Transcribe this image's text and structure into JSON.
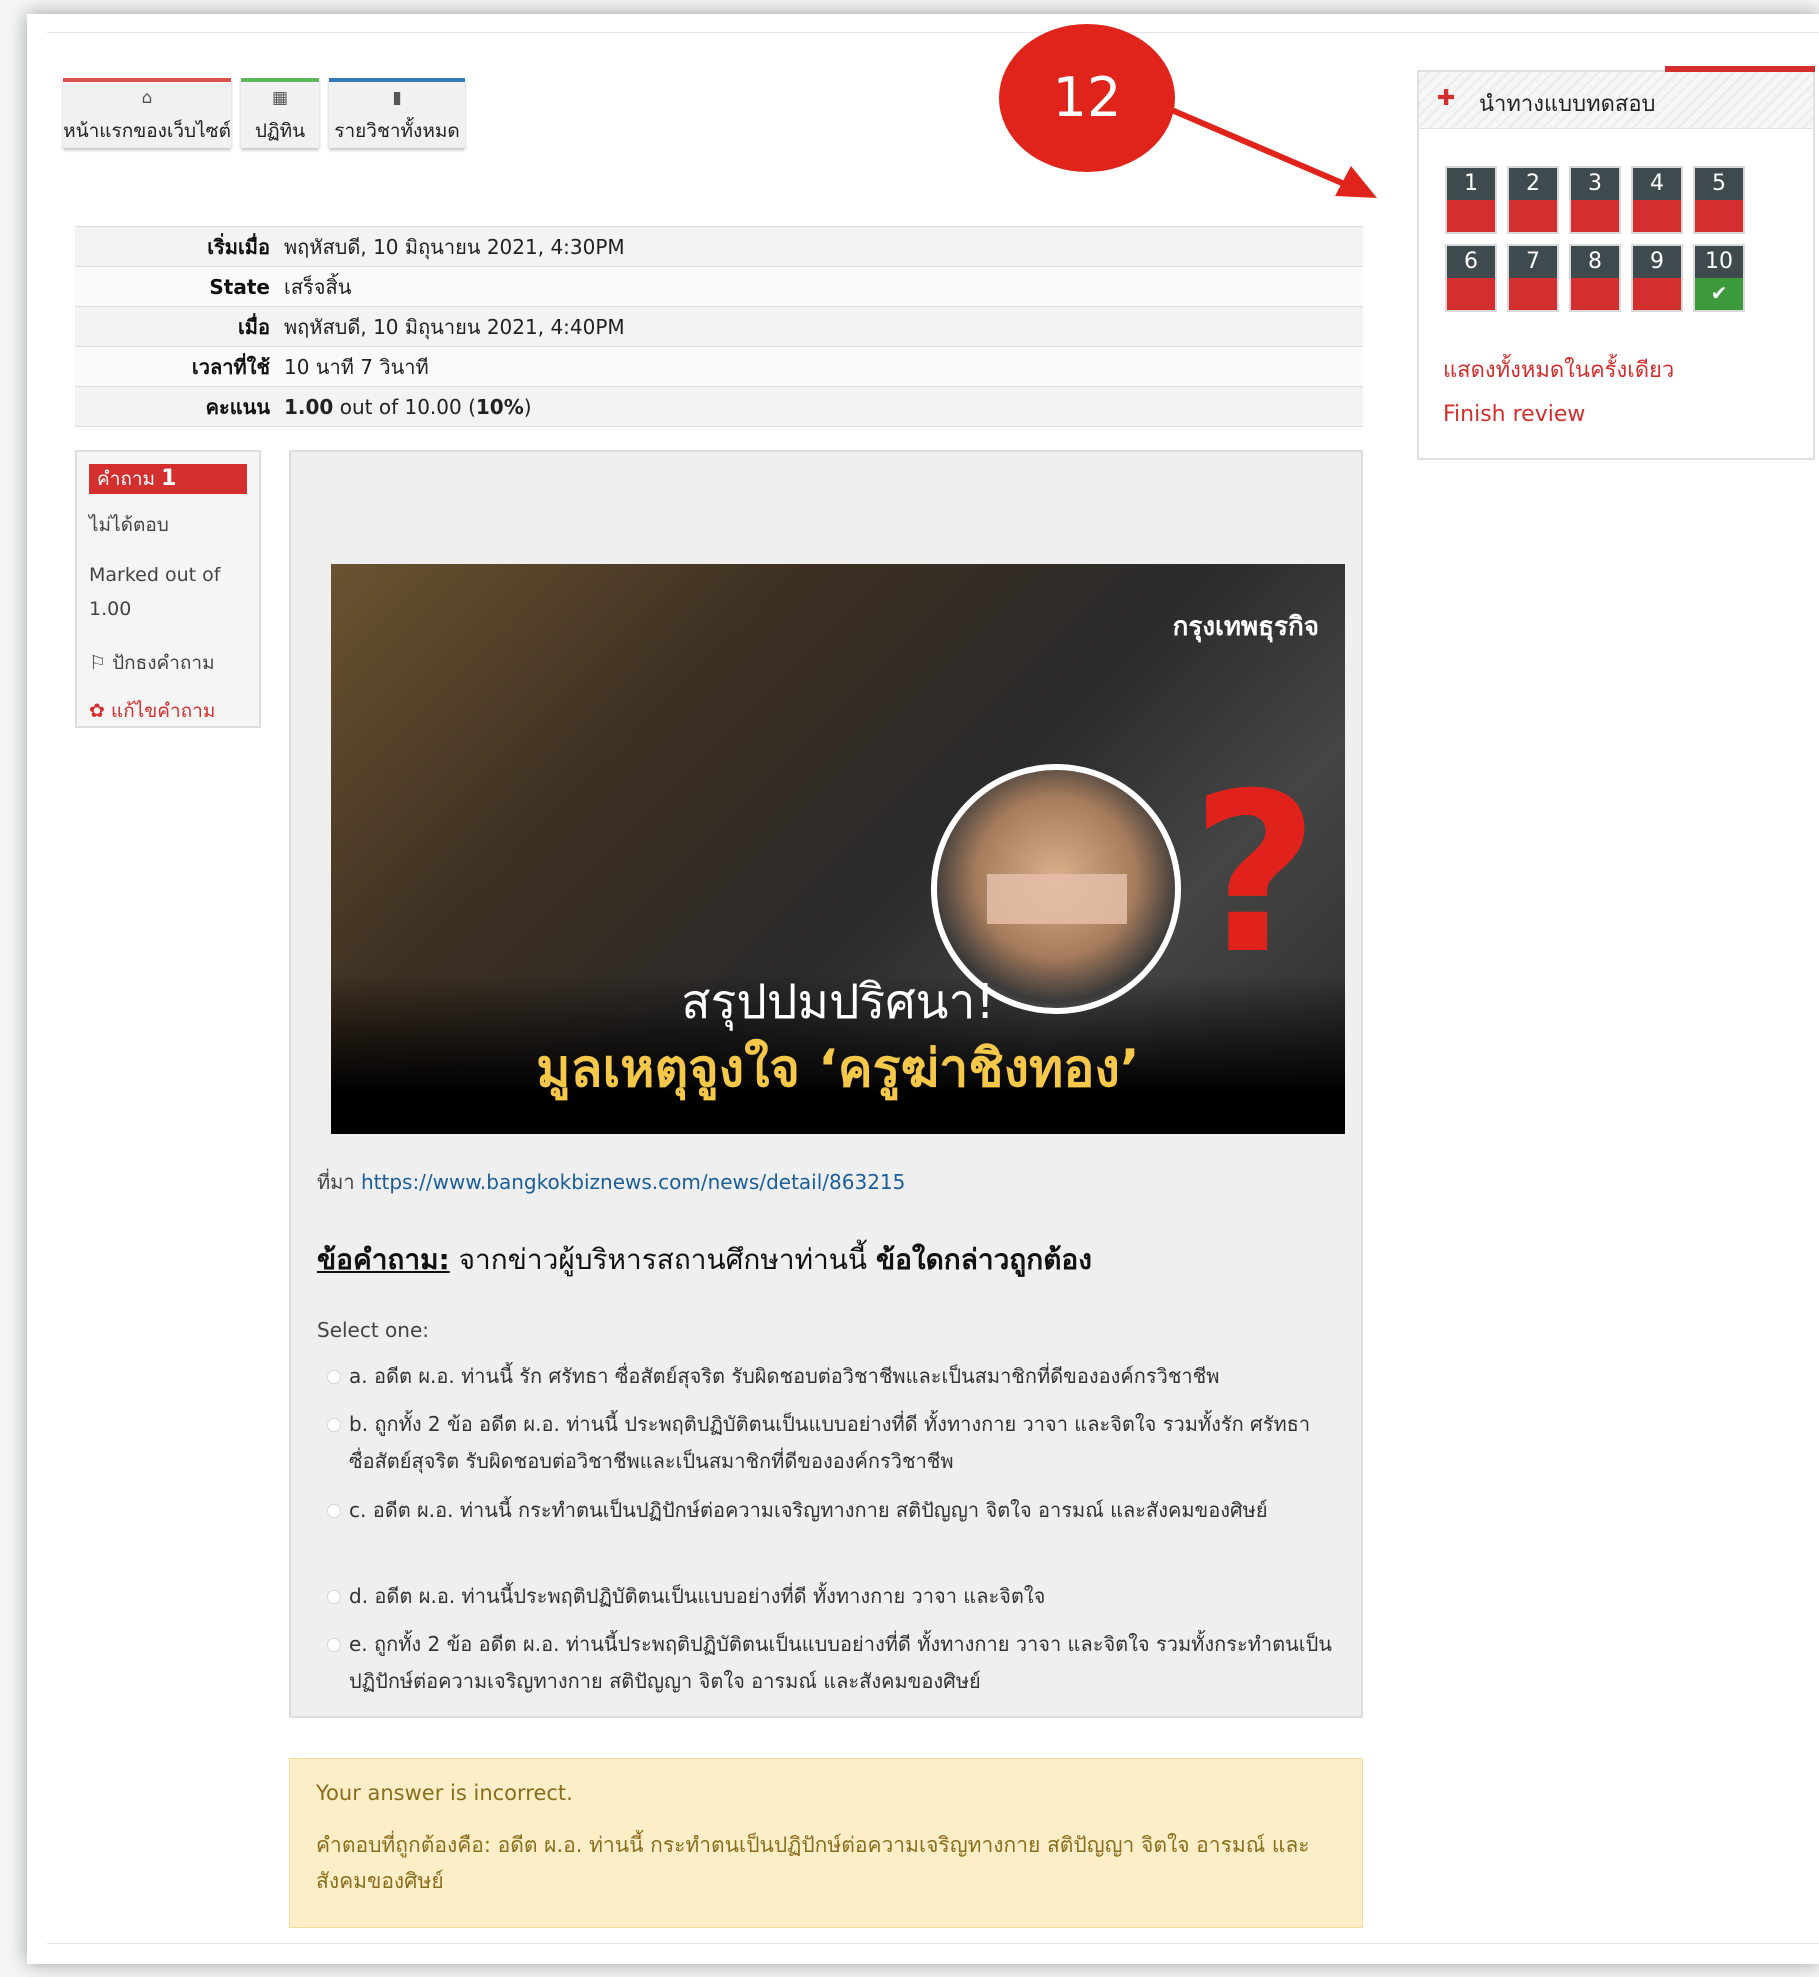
{
  "nav": {
    "home_label": "หน้าแรกของเว็บไซต์",
    "calendar_label": "ปฏิทิน",
    "courses_label": "รายวิชาทั้งหมด"
  },
  "summary": {
    "started_label": "เริ่มเมื่อ",
    "started_value": "พฤหัสบดี, 10 มิถุนายน 2021, 4:30PM",
    "state_label": "State",
    "state_value": "เสร็จสิ้น",
    "completed_label": "เมื่อ",
    "completed_value": "พฤหัสบดี, 10 มิถุนายน 2021, 4:40PM",
    "time_label": "เวลาที่ใช้",
    "time_value": "10 นาที 7 วินาที",
    "grade_label": "คะแนน",
    "grade_score": "1.00",
    "grade_mid": " out of 10.00 (",
    "grade_percent": "10%",
    "grade_end": ")"
  },
  "qinfo": {
    "label": "คำถาม",
    "number": "1",
    "status": "ไม่ได้ตอบ",
    "marked": "Marked out of 1.00",
    "flag": "ปักธงคำถาม",
    "edit": "แก้ไขคำถาม"
  },
  "question": {
    "image_logo": "กรุงเทพธุรกิจ",
    "image_caption1": "สรุปปมปริศนา!",
    "image_caption2": "มูลเหตุจูงใจ ‘ครูฆ่าชิงทอง’",
    "source_label": "ที่มา ",
    "source_url": "https://www.bangkokbiznews.com/news/detail/863215",
    "prompt_label": "ข้อคำถาม:",
    "prompt_text": " จากข่าวผู้บริหารสถานศึกษาท่านนี้ ",
    "prompt_bold": "ข้อใดกล่าวถูกต้อง",
    "select_one": "Select one:",
    "options": [
      "a. อดีต ผ.อ. ท่านนี้ รัก ศรัทธา ซื่อสัตย์สุจริต รับผิดชอบต่อวิชาชีพและเป็นสมาชิกที่ดีขององค์กรวิชาชีพ",
      "b. ถูกทั้ง 2 ข้อ อดีต ผ.อ. ท่านนี้ ประพฤติปฏิบัติตนเป็นแบบอย่างที่ดี ทั้งทางกาย วาจา และจิตใจ รวมทั้งรัก ศรัทธา ซื่อสัตย์สุจริต รับผิดชอบต่อวิชาชีพและเป็นสมาชิกที่ดีขององค์กรวิชาชีพ",
      "c. อดีต ผ.อ. ท่านนี้ กระทำตนเป็นปฏิปักษ์ต่อความเจริญทางกาย สติปัญญา จิตใจ อารมณ์ และสังคมของศิษย์",
      "d. อดีต ผ.อ. ท่านนี้ประพฤติปฏิบัติตนเป็นแบบอย่างที่ดี ทั้งทางกาย วาจา และจิตใจ",
      "e. ถูกทั้ง 2 ข้อ อดีต ผ.อ. ท่านนี้ประพฤติปฏิบัติตนเป็นแบบอย่างที่ดี ทั้งทางกาย วาจา และจิตใจ รวมทั้งกระทำตนเป็นปฏิปักษ์ต่อความเจริญทางกาย สติปัญญา จิตใจ อารมณ์ และสังคมของศิษย์"
    ]
  },
  "feedback": {
    "result": "Your answer is incorrect.",
    "correct": "คำตอบที่ถูกต้องคือ: อดีต ผ.อ. ท่านนี้ กระทำตนเป็นปฏิปักษ์ต่อความเจริญทางกาย สติปัญญา จิตใจ อารมณ์ และสังคมของศิษย์"
  },
  "quiz_nav": {
    "title": "นำทางแบบทดสอบ",
    "buttons": [
      "1",
      "2",
      "3",
      "4",
      "5",
      "6",
      "7",
      "8",
      "9",
      "10"
    ],
    "show_all": "แสดงทั้งหมดในครั้งเดียว",
    "finish": "Finish review"
  },
  "annotation": {
    "badge": "12"
  },
  "colors": {
    "accent_red": "#d32f2f",
    "nav_dark": "#3f4a4f",
    "answered_green": "#3c9a3c",
    "feedback_bg": "#fcefc7"
  }
}
